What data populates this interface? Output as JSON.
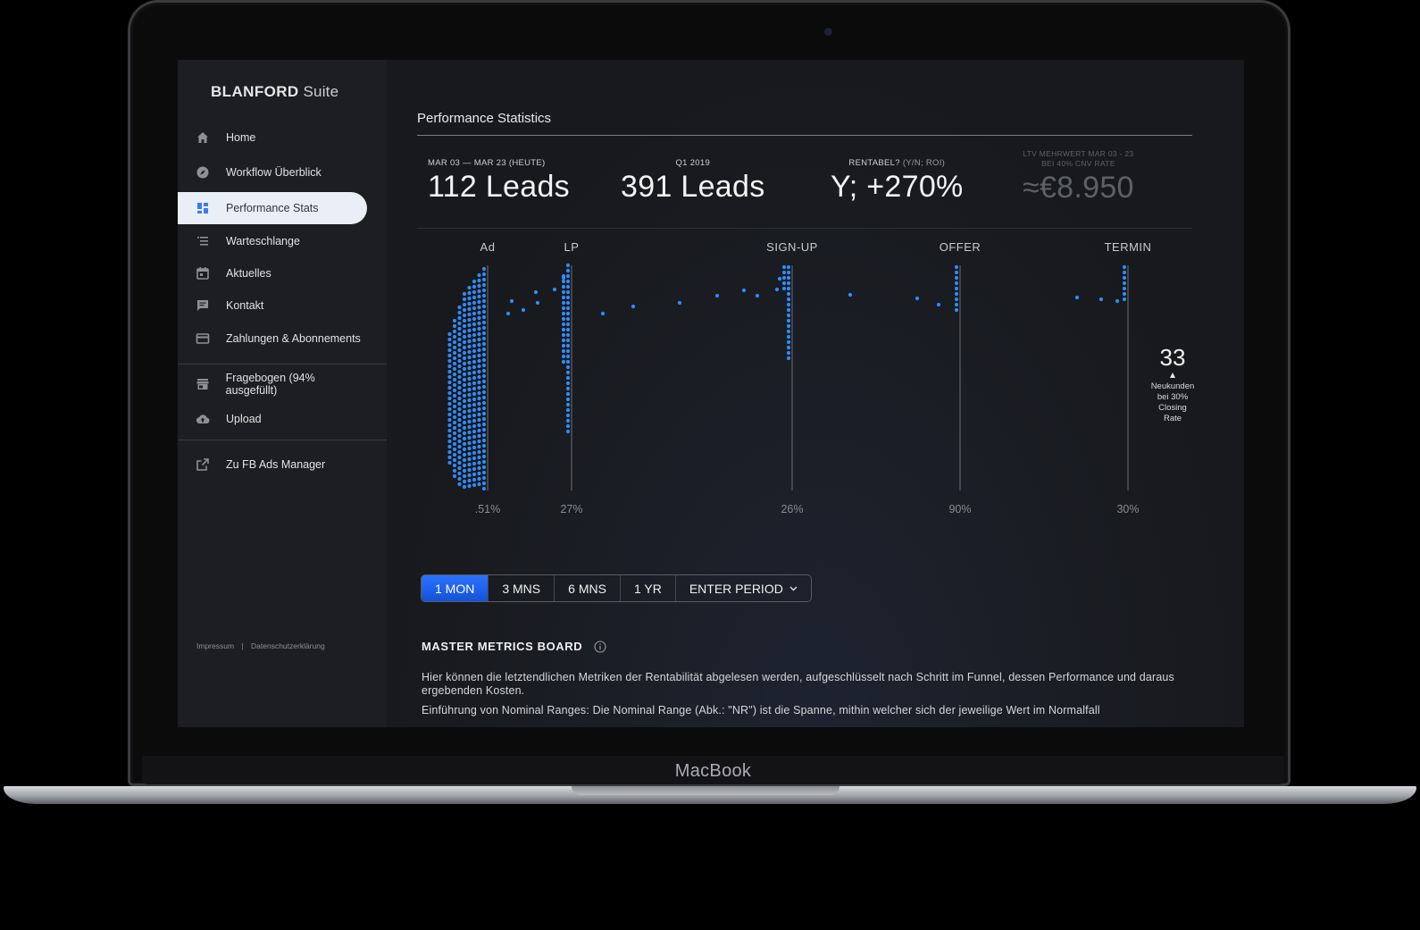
{
  "device": {
    "label": "MacBook"
  },
  "sidebar": {
    "brand": {
      "name": "BLANFORD",
      "suffix": "Suite"
    },
    "items": [
      {
        "label": "Home",
        "icon": "home-icon"
      },
      {
        "label": "Workflow Überblick",
        "icon": "compass-icon"
      },
      {
        "label": "Performance Stats",
        "icon": "dashboard-icon",
        "active": true
      },
      {
        "label": "Warteschlange",
        "icon": "list-icon"
      },
      {
        "label": "Aktuelles",
        "icon": "calendar-icon"
      },
      {
        "label": "Kontakt",
        "icon": "chat-icon"
      },
      {
        "label": "Zahlungen & Abonnements",
        "icon": "credit-card-icon"
      },
      {
        "label": "Fragebogen (94% ausgefüllt)",
        "icon": "store-icon"
      },
      {
        "label": "Upload",
        "icon": "cloud-upload-icon"
      },
      {
        "label": "Zu FB Ads Manager",
        "icon": "external-link-icon"
      }
    ],
    "footer": {
      "impressum": "Impressum",
      "separator": "|",
      "privacy": "Datenschutzerklärung"
    }
  },
  "main": {
    "title": "Performance Statistics",
    "kpis": [
      {
        "label": "MAR 03 — MAR 23 (HEUTE)",
        "value": "112 Leads"
      },
      {
        "label": "Q1 2019",
        "value": "391 Leads"
      },
      {
        "label": "RENTABEL?",
        "label_suffix": "(Y/N; ROI)",
        "value": "Y; +270%"
      },
      {
        "label_line1": "LTV MEHRWERT MAR 03 - 23",
        "label_line2": "BEI 40% CNV RATE",
        "value": "≈€8.950"
      }
    ],
    "periods": {
      "options": [
        "1 MON",
        "3 MNS",
        "6 MNS",
        "1 YR",
        "ENTER PERIOD"
      ],
      "selected": "1 MON"
    },
    "master_metrics": {
      "title": "MASTER METRICS BOARD",
      "paragraph1": "Hier können die letztendlichen Metriken der Rentabilität abgelesen werden, aufgeschlüsselt nach Schritt im Funnel, dessen Performance und daraus ergebenden Kosten.",
      "paragraph2": "Einführung von Nominal Ranges: Die Nominal Range (Abk.: \"NR\") ist die Spanne, mithin welcher sich der jeweilige Wert im Normalfall"
    }
  },
  "chart_data": {
    "type": "scatter",
    "stages": [
      {
        "name": "Ad",
        "rate": ".51%"
      },
      {
        "name": "LP",
        "rate": "27%"
      },
      {
        "name": "SIGN-UP",
        "rate": "26%"
      },
      {
        "name": "OFFER",
        "rate": "90%"
      },
      {
        "name": "TERMIN",
        "rate": "30%"
      }
    ],
    "callout": {
      "value": "33",
      "label": "Neukunden bei 30% Closing Rate"
    },
    "colors": {
      "dot": "#2f8cff",
      "line": "#6c6e73",
      "text": "#c9cacd",
      "rate": "#8a8c91"
    }
  }
}
